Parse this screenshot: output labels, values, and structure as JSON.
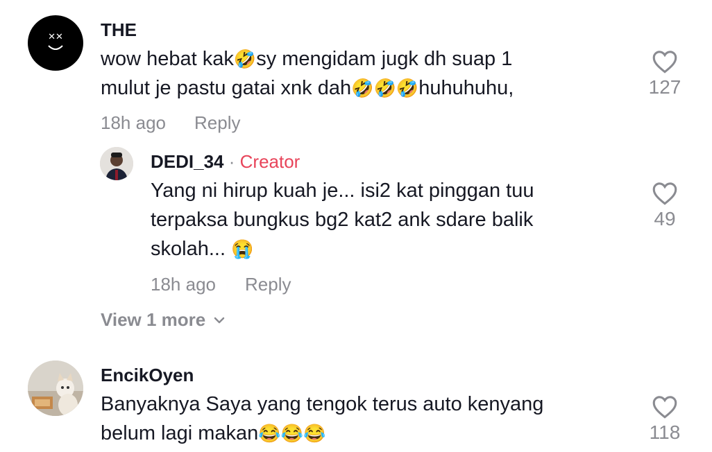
{
  "comments": [
    {
      "username": "THE",
      "text_parts": [
        "wow hebat kak",
        "🤣",
        "sy mengidam jugk dh suap 1"
      ],
      "text_line2_parts": [
        "mulut je pastu gatai xnk dah",
        "🤣🤣🤣",
        "huhuhuhu,"
      ],
      "time": "18h ago",
      "reply_label": "Reply",
      "likes": "127"
    },
    {
      "username": "EncikOyen",
      "text_line1": "Banyaknya Saya yang tengok terus auto kenyang",
      "text_line2_parts": [
        "belum lagi makan",
        "😂😂😂"
      ],
      "likes": "118"
    }
  ],
  "reply": {
    "username": "DEDI_34",
    "separator": "·",
    "badge": "Creator",
    "line1": "Yang ni hirup kuah je... isi2 kat pinggan tuu",
    "line2": "terpaksa bungkus bg2 kat2 ank sdare balik",
    "line3_text": "skolah... ",
    "line3_emoji": "😭",
    "time": "18h ago",
    "reply_label": "Reply",
    "likes": "49"
  },
  "view_more": {
    "label": "View 1 more",
    "icon": "chevron-down-icon"
  },
  "colors": {
    "text": "#161823",
    "meta": "#8a8b91",
    "creator": "#e8445a"
  }
}
